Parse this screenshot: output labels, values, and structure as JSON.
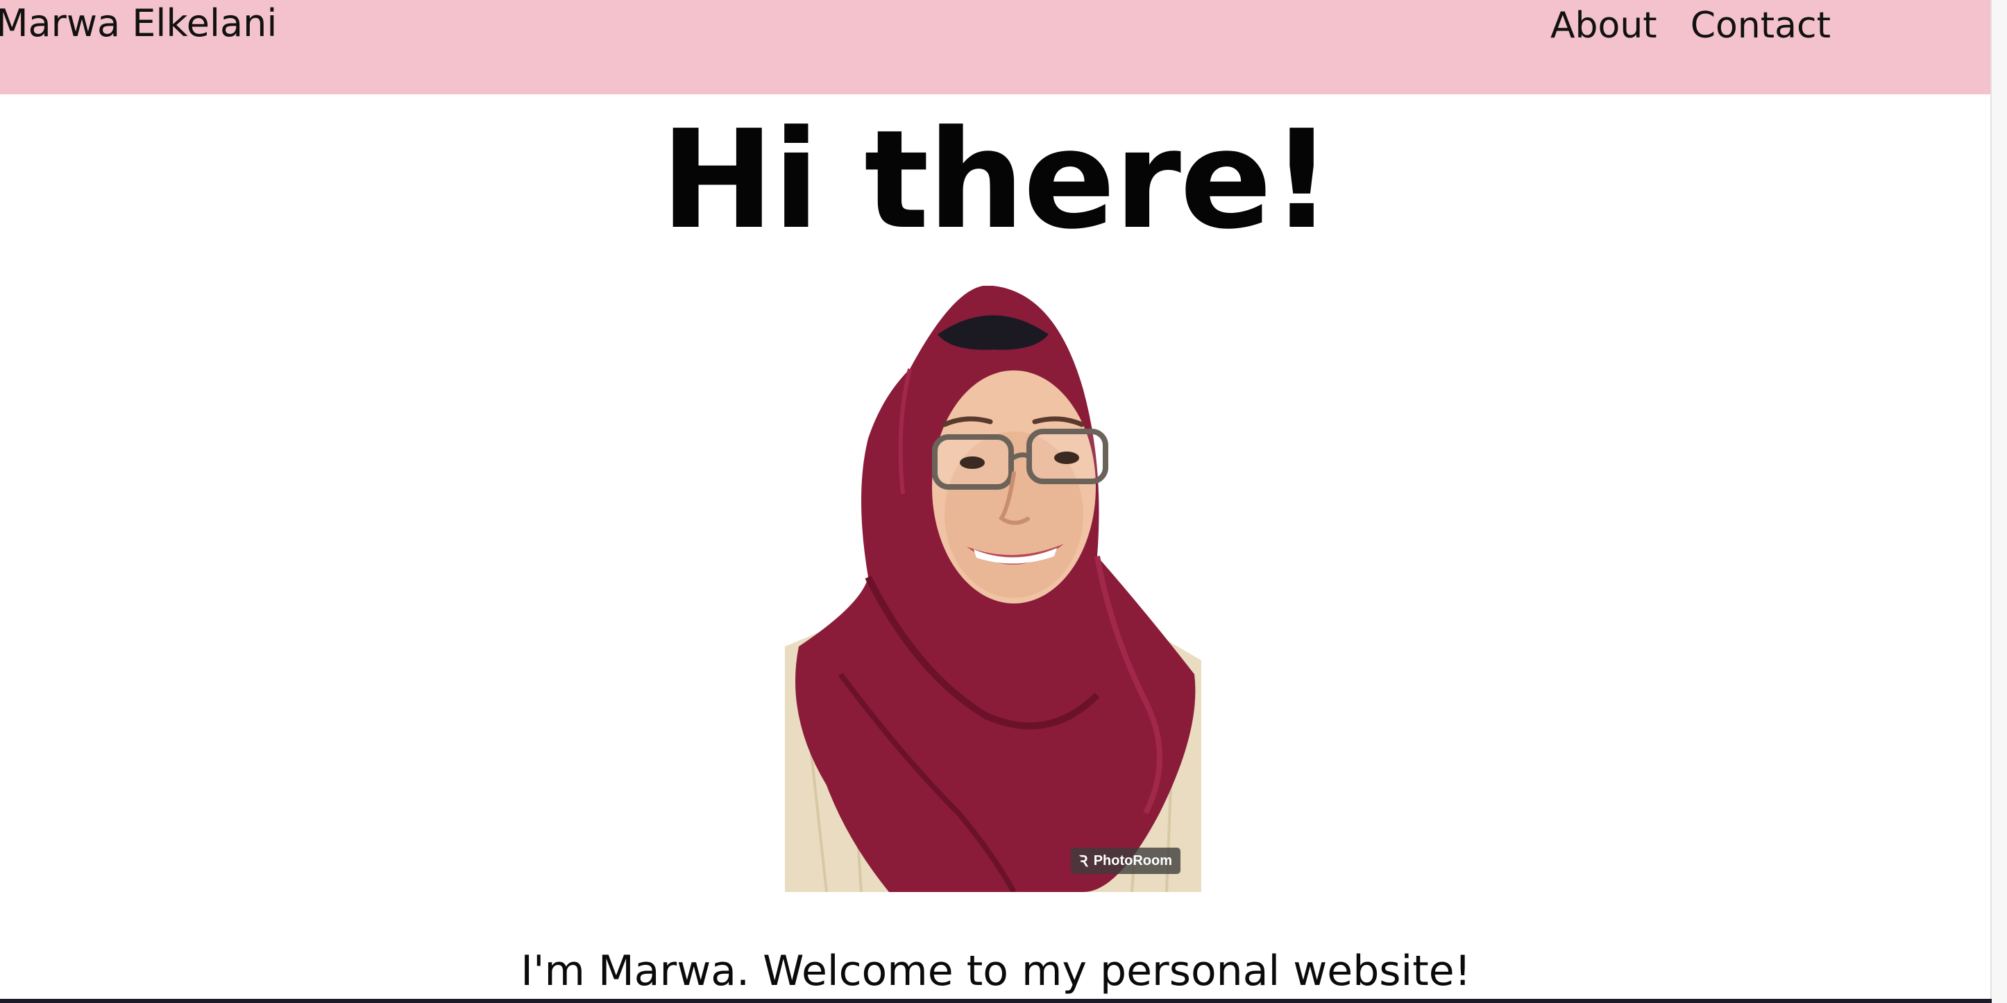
{
  "header": {
    "brand": "Marwa Elkelani",
    "nav": [
      {
        "label": "About"
      },
      {
        "label": "Contact"
      }
    ]
  },
  "hero": {
    "title": "Hi there!",
    "photo_watermark": "PhotoRoom",
    "intro": "I'm Marwa. Welcome to my personal website!"
  },
  "colors": {
    "navbar_bg": "#f4c2cc",
    "text": "#111111",
    "page_bg": "#ffffff",
    "hijab": "#8a1c3a"
  },
  "icons": {
    "watermark_logo": "photoroom-logo-icon"
  }
}
